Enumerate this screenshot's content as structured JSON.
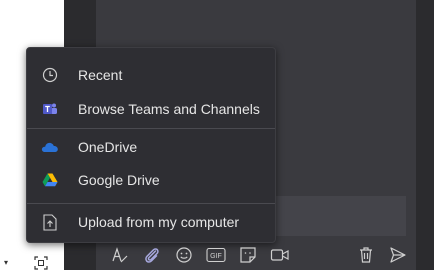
{
  "attach_menu": {
    "items": [
      {
        "label": "Recent",
        "icon": "clock-icon"
      },
      {
        "label": "Browse Teams and Channels",
        "icon": "teams-icon"
      },
      {
        "label": "OneDrive",
        "icon": "onedrive-icon"
      },
      {
        "label": "Google Drive",
        "icon": "google-drive-icon"
      },
      {
        "label": "Upload from my computer",
        "icon": "upload-file-icon"
      }
    ]
  },
  "compose_toolbar": {
    "icons": [
      "format-icon",
      "attach-icon",
      "emoji-icon",
      "gif-icon",
      "sticker-icon",
      "meet-now-icon",
      "delete-icon",
      "send-icon"
    ],
    "gif_label": "GIF"
  },
  "colors": {
    "accent": "#a6a7dc",
    "menu_bg": "#2e2e33",
    "chat_bg": "#3a3a3f"
  }
}
